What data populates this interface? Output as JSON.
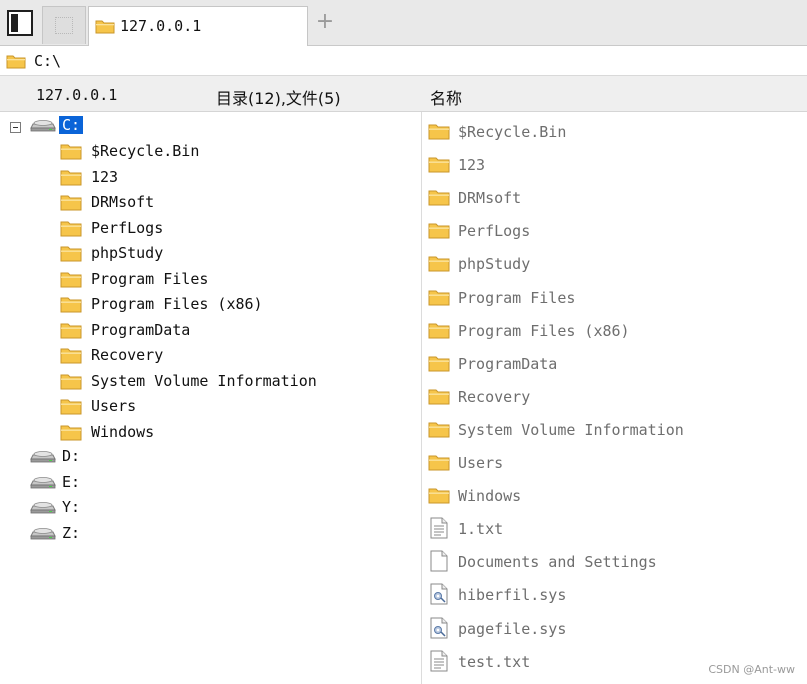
{
  "tabs": {
    "active_label": "127.0.0.1",
    "add_label": "+"
  },
  "path_bar": {
    "path": "C:\\"
  },
  "header": {
    "host": "127.0.0.1",
    "count": "目录(12),文件(5)",
    "name_column": "名称"
  },
  "tree": {
    "drive_c": "C:",
    "c_children": [
      "$Recycle.Bin",
      "123",
      "DRMsoft",
      "PerfLogs",
      "phpStudy",
      "Program Files",
      "Program Files (x86)",
      "ProgramData",
      "Recovery",
      "System Volume Information",
      "Users",
      "Windows"
    ],
    "other_drives": [
      "D:",
      "E:",
      "Y:",
      "Z:"
    ]
  },
  "files": {
    "folders": [
      "$Recycle.Bin",
      "123",
      "DRMsoft",
      "PerfLogs",
      "phpStudy",
      "Program Files",
      "Program Files (x86)",
      "ProgramData",
      "Recovery",
      "System Volume Information",
      "Users",
      "Windows"
    ],
    "items": [
      {
        "name": "1.txt",
        "icon": "text-file-icon"
      },
      {
        "name": "Documents and Settings",
        "icon": "blank-file-icon"
      },
      {
        "name": "hiberfil.sys",
        "icon": "system-file-icon"
      },
      {
        "name": "pagefile.sys",
        "icon": "system-file-icon"
      },
      {
        "name": "test.txt",
        "icon": "text-file-icon"
      }
    ]
  },
  "watermark": "CSDN @Ant-ww",
  "colors": {
    "selection": "#0a64d8",
    "folder": "#f6c54a",
    "folder_dark": "#c9962a"
  }
}
